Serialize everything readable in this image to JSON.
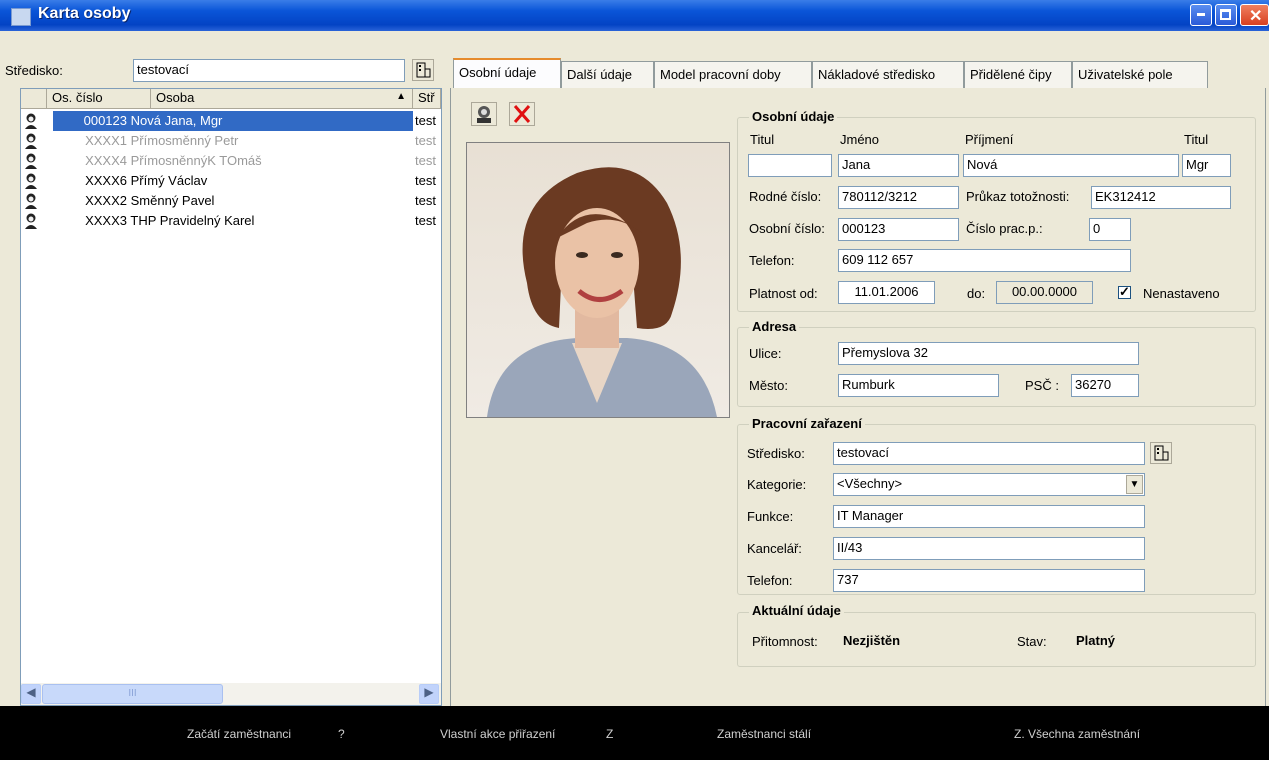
{
  "window": {
    "title": "Karta osoby"
  },
  "left": {
    "stredisko_label": "Středisko:",
    "stredisko_value": "testovací",
    "columns": [
      "Os. číslo",
      "Osoba",
      "Stř"
    ],
    "rows": [
      {
        "num": "000123",
        "name": "Nová Jana, Mgr",
        "str": "test",
        "selected": true,
        "gray": false
      },
      {
        "num": "XXXX1",
        "name": "Přímosměnný Petr",
        "str": "test",
        "selected": false,
        "gray": true
      },
      {
        "num": "XXXX4",
        "name": "PřímosněnnýK TOmáš",
        "str": "test",
        "selected": false,
        "gray": true
      },
      {
        "num": "XXXX6",
        "name": "Přímý Václav",
        "str": "test",
        "selected": false,
        "gray": false
      },
      {
        "num": "XXXX2",
        "name": "Směnný Pavel",
        "str": "test",
        "selected": false,
        "gray": false
      },
      {
        "num": "XXXX3",
        "name": "THP Pravidelný Karel",
        "str": "test",
        "selected": false,
        "gray": false
      }
    ],
    "scroll_thumb_text": "III"
  },
  "tabs": [
    "Osobní údaje",
    "Další údaje",
    "Model pracovní doby",
    "Nákladové středisko",
    "Přidělené čipy",
    "Uživatelské pole"
  ],
  "osobni": {
    "title": "Osobní údaje",
    "titul1_label": "Titul",
    "jmeno_label": "Jméno",
    "prijmeni_label": "Příjmení",
    "titul2_label": "Titul",
    "titul1": "",
    "jmeno": "Jana",
    "prijmeni": "Nová",
    "titul2": "Mgr",
    "rodne_label": "Rodné číslo:",
    "rodne": "780112/3212",
    "prukaz_label": "Průkaz totožnosti:",
    "prukaz": "EK312412",
    "oscislo_label": "Osobní číslo:",
    "oscislo": "000123",
    "cisloprac_label": "Číslo prac.p.:",
    "cisloprac": "0",
    "telefon_label": "Telefon:",
    "telefon": "609 112 657",
    "platnost_label": "Platnost od:",
    "platnost_od": "11.01.2006",
    "do_label": "do:",
    "platnost_do": "00.00.0000",
    "nenastaveno_label": "Nenastaveno",
    "nenastaveno_checked": true
  },
  "adresa": {
    "title": "Adresa",
    "ulice_label": "Ulice:",
    "ulice": "Přemyslova 32",
    "mesto_label": "Město:",
    "mesto": "Rumburk",
    "psc_label": "PSČ :",
    "psc": "36270"
  },
  "pracovni": {
    "title": "Pracovní zařazení",
    "stredisko_label": "Středisko:",
    "stredisko": "testovací",
    "kategorie_label": "Kategorie:",
    "kategorie": "<Všechny>",
    "funkce_label": "Funkce:",
    "funkce": "IT Manager",
    "kancelar_label": "Kancelář:",
    "kancelar": "II/43",
    "telefon_label": "Telefon:",
    "telefon": "737"
  },
  "aktualni": {
    "title": "Aktuální údaje",
    "pritomnost_label": "Přitomnost:",
    "pritomnost": "Nezjištěn",
    "stav_label": "Stav:",
    "stav": "Platný"
  },
  "statusbar": {
    "s1": "Začátí zaměstnanci",
    "s2": "?",
    "s3": "Vlastní akce přiřazení",
    "s4": "Z",
    "s5": "Zaměstnanci stálí",
    "s6": "Z. Všechna zaměstnání"
  }
}
